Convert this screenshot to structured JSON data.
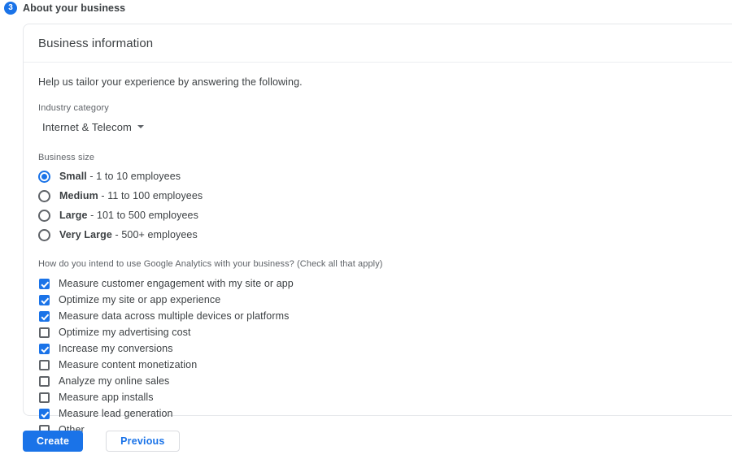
{
  "step": {
    "number": "3",
    "title": "About your business"
  },
  "card": {
    "header_title": "Business information",
    "intro": "Help us tailor your experience by answering the following.",
    "industry": {
      "label": "Industry category",
      "selected": "Internet & Telecom"
    },
    "business_size": {
      "label": "Business size",
      "options": [
        {
          "strong": "Small",
          "rest": " - 1 to 10 employees",
          "selected": true
        },
        {
          "strong": "Medium",
          "rest": " - 11 to 100 employees",
          "selected": false
        },
        {
          "strong": "Large",
          "rest": " - 101 to 500 employees",
          "selected": false
        },
        {
          "strong": "Very Large",
          "rest": " - 500+ employees",
          "selected": false
        }
      ]
    },
    "intent": {
      "question": "How do you intend to use Google Analytics with your business? (Check all that apply)",
      "options": [
        {
          "label": "Measure customer engagement with my site or app",
          "checked": true
        },
        {
          "label": "Optimize my site or app experience",
          "checked": true
        },
        {
          "label": "Measure data across multiple devices or platforms",
          "checked": true
        },
        {
          "label": "Optimize my advertising cost",
          "checked": false
        },
        {
          "label": "Increase my conversions",
          "checked": true
        },
        {
          "label": "Measure content monetization",
          "checked": false
        },
        {
          "label": "Analyze my online sales",
          "checked": false
        },
        {
          "label": "Measure app installs",
          "checked": false
        },
        {
          "label": "Measure lead generation",
          "checked": true
        },
        {
          "label": "Other",
          "checked": false
        }
      ]
    }
  },
  "footer": {
    "create_label": "Create",
    "previous_label": "Previous"
  },
  "colors": {
    "accent": "#1a73e8",
    "text": "#3c4043",
    "muted": "#5f6368",
    "border": "#dadce0"
  }
}
